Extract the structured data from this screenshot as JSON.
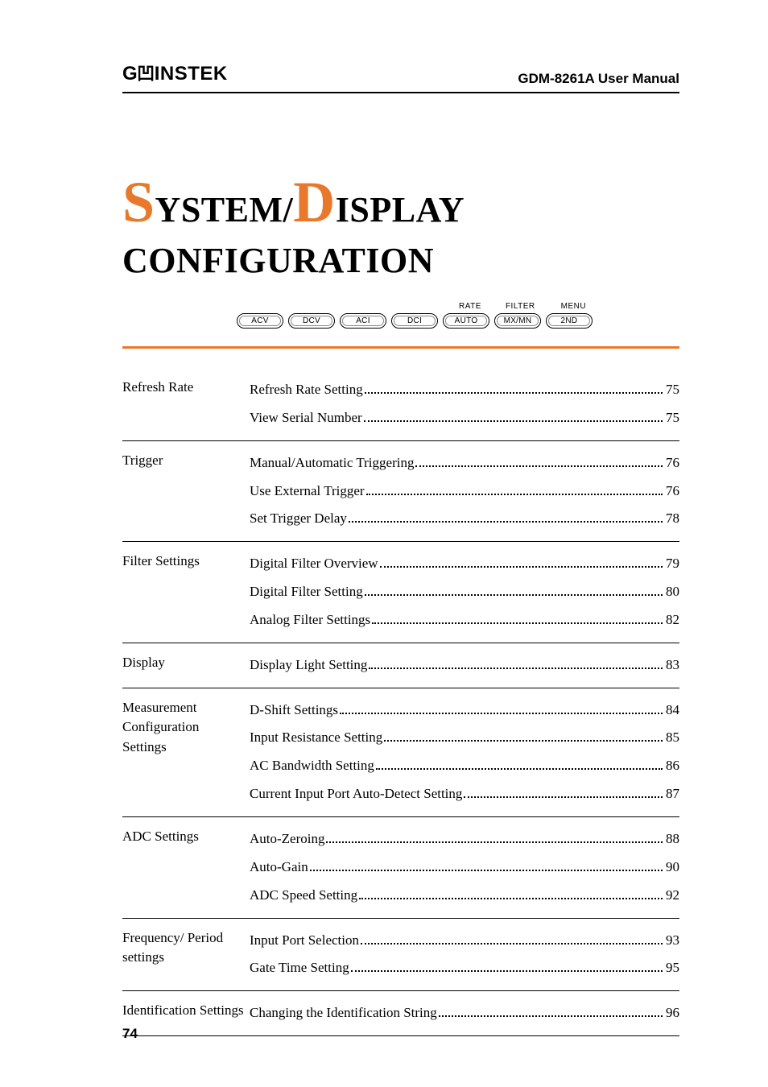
{
  "header": {
    "brand": "GWINSTEK",
    "manual": "GDM-8261A User Manual"
  },
  "chapter": {
    "title_parts": [
      "S",
      "YSTEM/",
      "D",
      "ISPLAY"
    ],
    "title_line2": "CONFIGURATION"
  },
  "button_top_labels": [
    "RATE",
    "FILTER",
    "MENU"
  ],
  "buttons": [
    "ACV",
    "DCV",
    "ACI",
    "DCI",
    "AUTO",
    "MX/MN",
    "2ND"
  ],
  "toc": [
    {
      "heading": "Refresh Rate",
      "items": [
        {
          "label": "Refresh Rate Setting",
          "page": "75"
        },
        {
          "label": "View Serial Number",
          "page": "75"
        }
      ]
    },
    {
      "heading": "Trigger",
      "items": [
        {
          "label": "Manual/Automatic Triggering",
          "page": "76"
        },
        {
          "label": "Use External Trigger",
          "page": "76"
        },
        {
          "label": "Set Trigger Delay",
          "page": "78"
        }
      ]
    },
    {
      "heading": "Filter Settings",
      "items": [
        {
          "label": "Digital Filter Overview",
          "page": "79"
        },
        {
          "label": "Digital Filter Setting",
          "page": "80"
        },
        {
          "label": "Analog Filter Settings",
          "page": "82"
        }
      ]
    },
    {
      "heading": "Display",
      "items": [
        {
          "label": "Display Light Setting",
          "page": "83"
        }
      ]
    },
    {
      "heading": "Measurement Configuration Settings",
      "items": [
        {
          "label": "D-Shift Settings",
          "page": "84"
        },
        {
          "label": "Input Resistance Setting",
          "page": "85"
        },
        {
          "label": "AC Bandwidth Setting",
          "page": "86"
        },
        {
          "label": "Current Input Port Auto-Detect Setting",
          "page": "87"
        }
      ]
    },
    {
      "heading": "ADC Settings",
      "items": [
        {
          "label": "Auto-Zeroing",
          "page": "88"
        },
        {
          "label": "Auto-Gain",
          "page": "90"
        },
        {
          "label": "ADC Speed Setting",
          "page": "92"
        }
      ]
    },
    {
      "heading": "Frequency/ Period settings",
      "items": [
        {
          "label": "Input Port Selection",
          "page": "93"
        },
        {
          "label": "Gate Time Setting",
          "page": "95"
        }
      ]
    },
    {
      "heading": "Identification Settings",
      "items": [
        {
          "label": "Changing the Identification String",
          "page": "96"
        }
      ]
    }
  ],
  "page_number": "74"
}
